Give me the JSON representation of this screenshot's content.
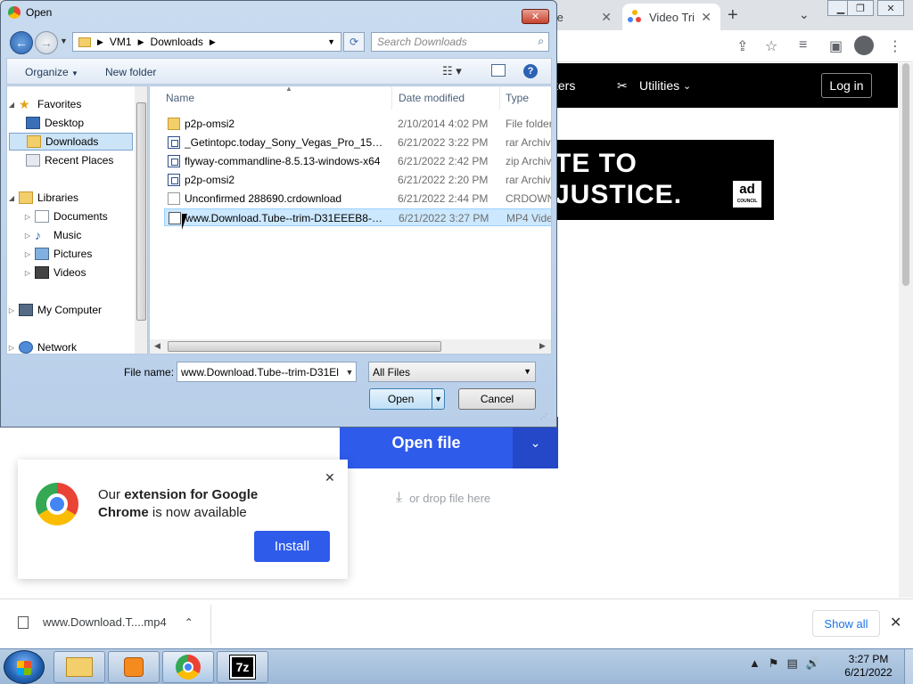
{
  "browser": {
    "tabs": [
      {
        "title": "oogle"
      },
      {
        "title": "Video Tri"
      }
    ],
    "site_nav": {
      "items": [
        "ters",
        "Utilities"
      ],
      "login_label": "Log in"
    },
    "ad": {
      "line1": "TE TO",
      "line2": "JUSTICE.",
      "logo_top": "ad",
      "logo_bottom": "COUNCIL"
    },
    "open_file_label": "Open file",
    "drop_label": "or drop file here",
    "ext_popup": {
      "text_pre": "Our ",
      "text_bold": "extension for Google Chrome",
      "text_post": " is now available",
      "install_label": "Install"
    },
    "download_bar": {
      "file_name": "www.Download.T....mp4",
      "show_all_label": "Show all"
    }
  },
  "dialog": {
    "title": "Open",
    "breadcrumb": [
      "VM1",
      "Downloads"
    ],
    "search_placeholder": "Search Downloads",
    "toolbar": {
      "organize": "Organize",
      "new_folder": "New folder"
    },
    "nav": {
      "favorites": "Favorites",
      "desktop": "Desktop",
      "downloads": "Downloads",
      "recent": "Recent Places",
      "libraries": "Libraries",
      "documents": "Documents",
      "music": "Music",
      "pictures": "Pictures",
      "videos": "Videos",
      "computer": "My Computer",
      "network": "Network"
    },
    "columns": {
      "name": "Name",
      "date": "Date modified",
      "type": "Type"
    },
    "files": [
      {
        "name": "p2p-omsi2",
        "date": "2/10/2014 4:02 PM",
        "type": "File folder",
        "icon": "folder-icon"
      },
      {
        "name": "_Getintopc.today_Sony_Vegas_Pro_15.0.0",
        "date": "6/21/2022 3:22 PM",
        "type": "rar Archive",
        "icon": "archive-icon"
      },
      {
        "name": "flyway-commandline-8.5.13-windows-x64",
        "date": "6/21/2022 2:42 PM",
        "type": "zip Archive",
        "icon": "archive-icon"
      },
      {
        "name": "p2p-omsi2",
        "date": "6/21/2022 2:20 PM",
        "type": "rar Archive",
        "icon": "archive-icon"
      },
      {
        "name": "Unconfirmed 288690.crdownload",
        "date": "6/21/2022 2:44 PM",
        "type": "CRDOWNLOAD",
        "icon": "document-icon"
      },
      {
        "name": "www.Download.Tube--trim-D31EEEB8-C...",
        "date": "6/21/2022 3:27 PM",
        "type": "MP4 Video",
        "icon": "video-file-icon"
      }
    ],
    "file_name_label": "File name:",
    "file_name_value": "www.Download.Tube--trim-D31El",
    "file_type_value": "All Files",
    "open_label": "Open",
    "cancel_label": "Cancel"
  },
  "taskbar": {
    "time": "3:27 PM",
    "date": "6/21/2022"
  }
}
